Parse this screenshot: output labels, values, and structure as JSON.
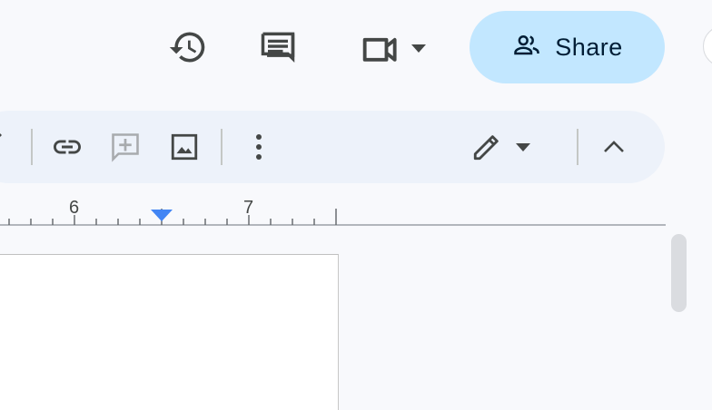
{
  "header": {
    "share_label": "Share"
  },
  "ruler": {
    "labels": [
      "6",
      "7"
    ]
  },
  "icons": {
    "version_history": "history-icon",
    "comments": "comment-icon",
    "meet": "video-camera-icon",
    "share": "people-icon",
    "link": "link-icon",
    "add_comment": "add-comment-icon",
    "image": "image-icon",
    "more": "more-vert-icon",
    "editing_mode": "pencil-icon",
    "collapse": "chevron-up-icon"
  },
  "colors": {
    "share_bg": "#c2e7ff",
    "toolbar_bg": "#edf2fa",
    "indent_marker": "#4285f4"
  }
}
